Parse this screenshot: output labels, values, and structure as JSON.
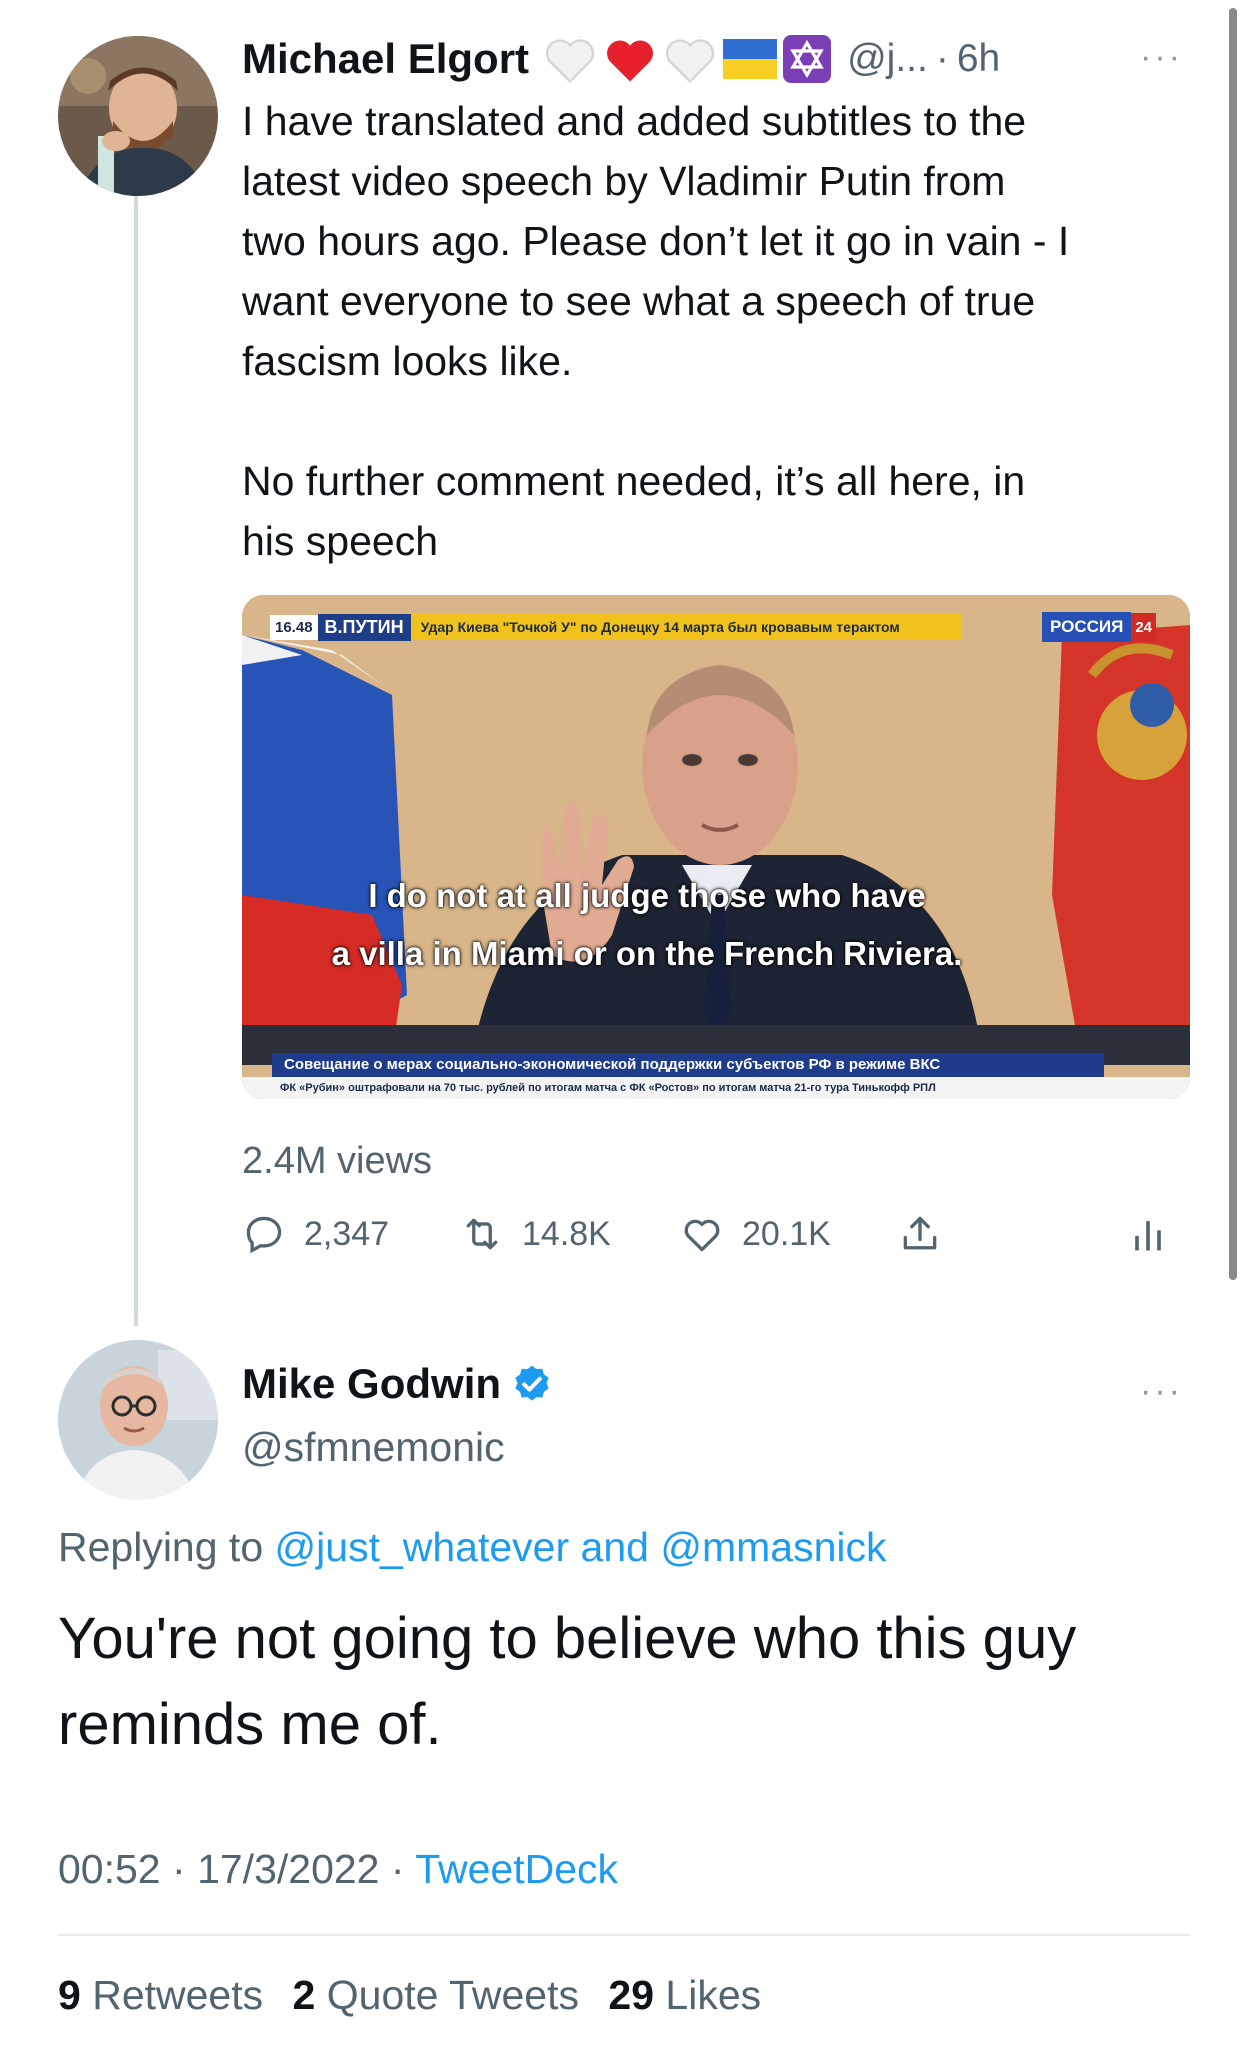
{
  "scrollbar": {},
  "first_tweet": {
    "author": "Michael Elgort",
    "emoji_icons": [
      "white-heart-icon",
      "red-heart-icon",
      "white-heart-icon",
      "ukraine-flag-icon",
      "star-of-david-icon"
    ],
    "handle": "@j...",
    "separator": "·",
    "time": "6h",
    "more": "···",
    "text": "I have translated and added subtitles to the\nlatest video speech by Vladimir Putin from\ntwo hours ago. Please don’t let it go in vain - I\nwant everyone to see what a speech of true\nfascism looks like.\n\nNo further comment needed, it’s all here, in\nhis speech",
    "video": {
      "ticker_time": "16.48",
      "ticker_name": "В.ПУТИН",
      "ticker_headline": "Удар Киева \"Точкой У\" по Донецку 14 марта был кровавым терактом",
      "channel": "РОССИЯ",
      "channel_number": "24",
      "subtitle_line1": "I do not at all judge those who have",
      "subtitle_line2": "a villa in Miami or on the French Riviera.",
      "lower_bar": "Совещание о мерах социально-экономической поддержки субъектов РФ в режиме ВКС",
      "news_crawl": "ФК «Рубин» оштрафовали на 70 тыс. рублей по итогам матча с ФК «Ростов» по итогам матча 21-го тура Тинькофф РПЛ"
    },
    "views": "2.4M views",
    "actions": {
      "replies": "2,347",
      "retweets": "14.8K",
      "likes": "20.1K"
    }
  },
  "reply_tweet": {
    "author": "Mike Godwin",
    "handle": "@sfmnemonic",
    "more": "···",
    "replying_prefix": "Replying to",
    "replying_user1": "@just_whatever",
    "replying_and": "and",
    "replying_user2": "@mmasnick",
    "text": "You're not going to believe who this guy\nreminds me of.",
    "time": "00:52",
    "sep1": "·",
    "date": "17/3/2022",
    "sep2": "·",
    "client": "TweetDeck",
    "stats": {
      "retweets_count": "9",
      "retweets_label": "Retweets",
      "quotes_count": "2",
      "quotes_label": "Quote Tweets",
      "likes_count": "29",
      "likes_label": "Likes"
    }
  },
  "colors": {
    "link": "#1d9bf0",
    "muted": "#536471",
    "text": "#0f1419",
    "verified": "#1d9bf0"
  }
}
